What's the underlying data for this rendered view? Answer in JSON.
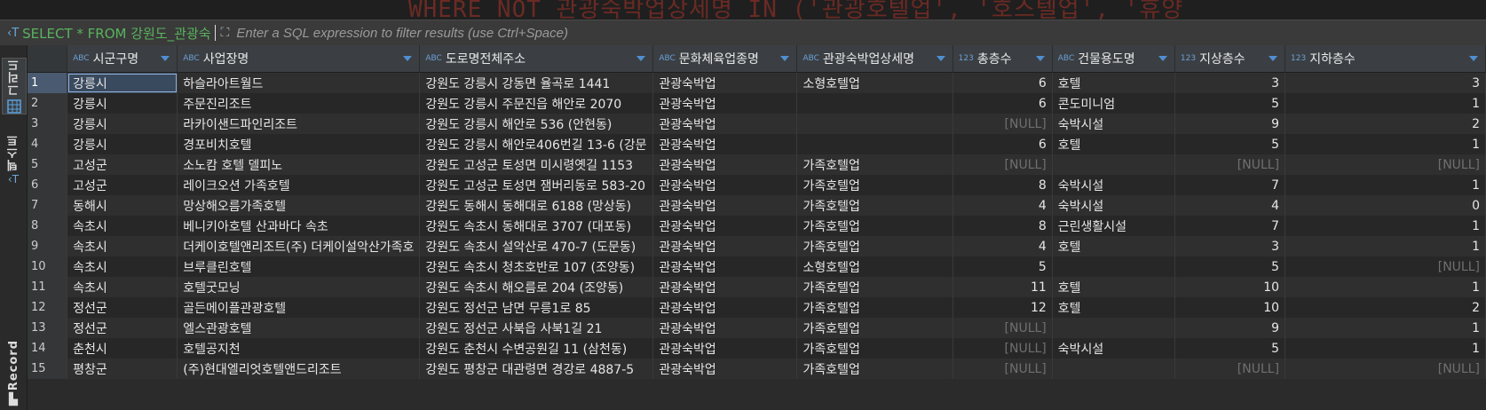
{
  "filter": {
    "query": "SELECT * FROM 강원도_관광숙",
    "placeholder": "Enter a SQL expression to filter results (use Ctrl+Space)"
  },
  "editor_bg": "WHERE NOT 관광숙박업상세명 IN ('관광호텔업', '호스텔업', '휴양",
  "side_tabs": [
    "그리드",
    "텍스트",
    "Record"
  ],
  "columns": [
    {
      "type": "ABC",
      "name": "시군구명"
    },
    {
      "type": "ABC",
      "name": "사업장명"
    },
    {
      "type": "ABC",
      "name": "도로명전체주소"
    },
    {
      "type": "ABC",
      "name": "문화체육업종명"
    },
    {
      "type": "ABC",
      "name": "관광숙박업상세명"
    },
    {
      "type": "123",
      "name": "총층수"
    },
    {
      "type": "ABC",
      "name": "건물용도명"
    },
    {
      "type": "123",
      "name": "지상층수"
    },
    {
      "type": "123",
      "name": "지하층수"
    }
  ],
  "rows": [
    [
      "1",
      "강릉시",
      "하슬라아트월드",
      "강원도 강릉시 강동면 율곡로 1441",
      "관광숙박업",
      "소형호텔업",
      "6",
      "호텔",
      "3",
      "3"
    ],
    [
      "2",
      "강릉시",
      "주문진리조트",
      "강원도 강릉시 주문진읍 해안로 2070",
      "관광숙박업",
      "",
      "6",
      "콘도미니엄",
      "5",
      "1"
    ],
    [
      "3",
      "강릉시",
      "라카이샌드파인리조트",
      "강원도 강릉시 해안로 536 (안현동)",
      "관광숙박업",
      "",
      "[NULL]",
      "숙박시설",
      "9",
      "2"
    ],
    [
      "4",
      "강릉시",
      "경포비치호텔",
      "강원도 강릉시 해안로406번길 13-6 (강문",
      "관광숙박업",
      "",
      "6",
      "호텔",
      "5",
      "1"
    ],
    [
      "5",
      "고성군",
      "소노캄 호텔 델피노",
      "강원도 고성군 토성면 미시령옛길 1153",
      "관광숙박업",
      "가족호텔업",
      "[NULL]",
      "",
      "[NULL]",
      "[NULL]"
    ],
    [
      "6",
      "고성군",
      "레이크오션 가족호텔",
      "강원도 고성군 토성면 잼버리동로 583-20",
      "관광숙박업",
      "가족호텔업",
      "8",
      "숙박시설",
      "7",
      "1"
    ],
    [
      "7",
      "동해시",
      "망상해오름가족호텔",
      "강원도 동해시 동해대로 6188 (망상동)",
      "관광숙박업",
      "가족호텔업",
      "4",
      "숙박시설",
      "4",
      "0"
    ],
    [
      "8",
      "속초시",
      "베니키아호텔 산과바다 속초",
      "강원도 속초시 동해대로 3707 (대포동)",
      "관광숙박업",
      "가족호텔업",
      "8",
      "근린생활시설",
      "7",
      "1"
    ],
    [
      "9",
      "속초시",
      "더케이호텔앤리조트(주) 더케이설악산가족호",
      "강원도 속초시 설악산로 470-7 (도문동)",
      "관광숙박업",
      "가족호텔업",
      "4",
      "호텔",
      "3",
      "1"
    ],
    [
      "10",
      "속초시",
      "브루클린호텔",
      "강원도 속초시 청초호반로 107 (조양동)",
      "관광숙박업",
      "소형호텔업",
      "5",
      "",
      "5",
      "[NULL]"
    ],
    [
      "11",
      "속초시",
      "호텔굿모닝",
      "강원도 속초시 해오름로 204 (조양동)",
      "관광숙박업",
      "가족호텔업",
      "11",
      "호텔",
      "10",
      "1"
    ],
    [
      "12",
      "정선군",
      "골든메이플관광호텔",
      "강원도 정선군 남면 무릉1로 85",
      "관광숙박업",
      "가족호텔업",
      "12",
      "호텔",
      "10",
      "2"
    ],
    [
      "13",
      "정선군",
      "엘스관광호텔",
      "강원도 정선군 사북읍 사북1길 21",
      "관광숙박업",
      "가족호텔업",
      "[NULL]",
      "",
      "9",
      "1"
    ],
    [
      "14",
      "춘천시",
      "호텔공지천",
      "강원도 춘천시 수변공원길 11 (삼천동)",
      "관광숙박업",
      "가족호텔업",
      "[NULL]",
      "숙박시설",
      "5",
      "1"
    ],
    [
      "15",
      "평창군",
      "(주)현대엘리엇호텔앤드리조트",
      "강원도 평창군 대관령면 경강로 4887-5",
      "관광숙박업",
      "가족호텔업",
      "[NULL]",
      "",
      "[NULL]",
      "[NULL]"
    ]
  ]
}
